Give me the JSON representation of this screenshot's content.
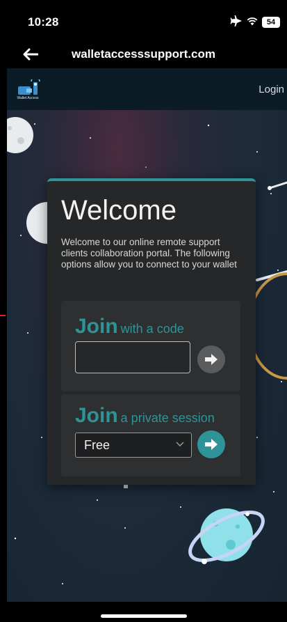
{
  "status_bar": {
    "time": "10:28",
    "battery": "54"
  },
  "browser": {
    "url": "walletaccesssupport.com"
  },
  "site_header": {
    "logo_text": "Wallet Access",
    "login_label": "Login"
  },
  "welcome": {
    "title": "Welcome",
    "description": "Welcome to our online remote support clients collaboration portal. The following options allow you to connect to your wallet"
  },
  "join_code": {
    "join_word": "Join",
    "subtitle": "with a code",
    "input_value": ""
  },
  "join_private": {
    "join_word": "Join",
    "subtitle": "a private session",
    "selected_option": "Free"
  },
  "colors": {
    "accent": "#2f9497",
    "card_background": "#262728",
    "panel_background": "#2e2f31",
    "header_background": "#0c1c26"
  }
}
